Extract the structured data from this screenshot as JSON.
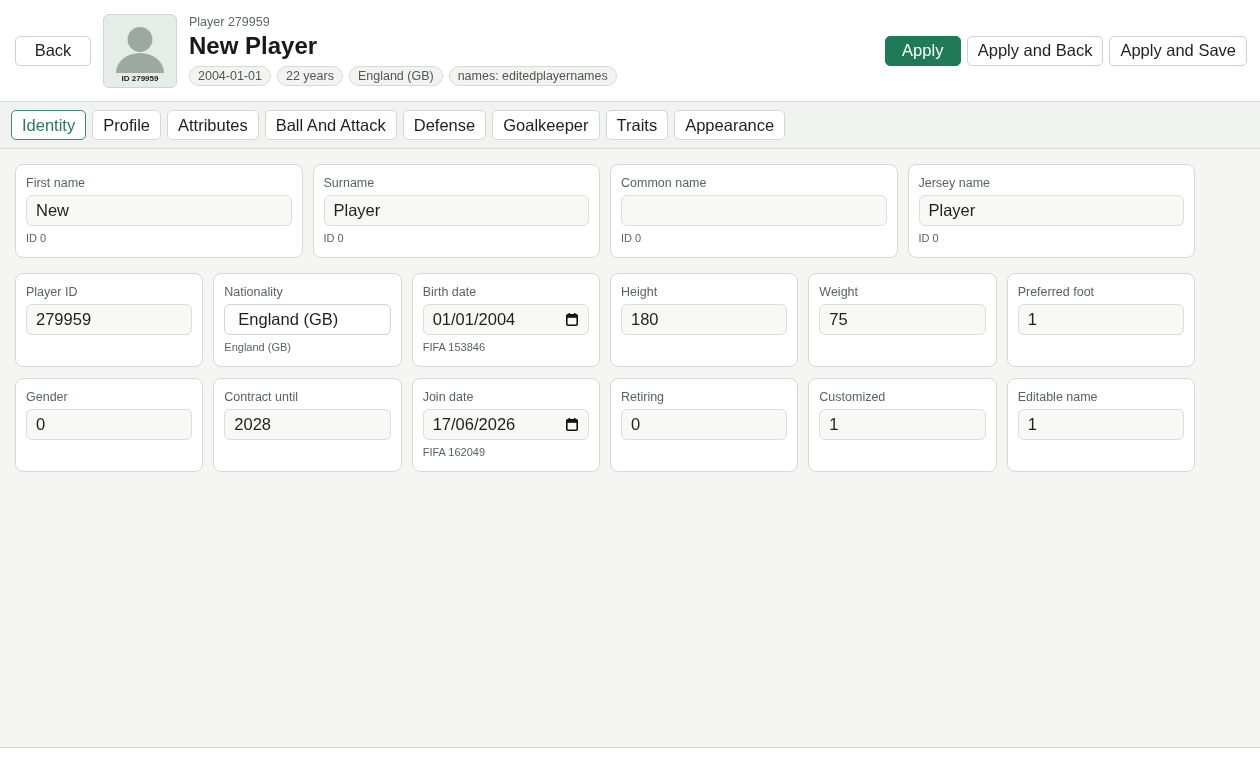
{
  "header": {
    "back_button": "Back",
    "avatar": {
      "caption": "ID 279959"
    },
    "subtitle": "Player 279959",
    "title": "New Player",
    "chips": [
      "2004-01-01",
      "22 years",
      "England (GB)",
      "names: editedplayernames"
    ],
    "actions": [
      {
        "label": "Apply",
        "kind": "primary"
      },
      {
        "label": "Apply and Back",
        "kind": "secondary"
      },
      {
        "label": "Apply and Save",
        "kind": "secondary"
      }
    ]
  },
  "tabs": [
    {
      "label": "Identity",
      "selected": true
    },
    {
      "label": "Profile",
      "selected": false
    },
    {
      "label": "Attributes",
      "selected": false
    },
    {
      "label": "Ball And Attack",
      "selected": false
    },
    {
      "label": "Defense",
      "selected": false
    },
    {
      "label": "Goalkeeper",
      "selected": false
    },
    {
      "label": "Traits",
      "selected": false
    },
    {
      "label": "Appearance",
      "selected": false
    }
  ],
  "field_groups": [
    {
      "rows": [
        [
          {
            "label": "First name",
            "kind": "text",
            "value": "New",
            "hint": "ID 0"
          },
          {
            "label": "Surname",
            "kind": "text",
            "value": "Player",
            "hint": "ID 0"
          },
          {
            "label": "Common name",
            "kind": "text",
            "hint": "ID 0"
          },
          {
            "label": "Jersey name",
            "kind": "text",
            "value": "Player",
            "hint": "ID 0"
          }
        ]
      ]
    },
    {
      "rows": [
        [
          {
            "label": "Player ID",
            "kind": "text",
            "value": "279959"
          },
          {
            "label": "Nationality",
            "kind": "select",
            "value": "England (GB)",
            "hint": "England (GB)"
          },
          {
            "label": "Birth date",
            "kind": "date",
            "value": "01/01/2004",
            "hint": "FIFA 153846"
          },
          {
            "label": "Height",
            "kind": "text",
            "value": "180"
          },
          {
            "label": "Weight",
            "kind": "text",
            "value": "75"
          },
          {
            "label": "Preferred foot",
            "kind": "text",
            "value": "1"
          }
        ],
        [
          {
            "label": "Gender",
            "kind": "text",
            "value": "0"
          },
          {
            "label": "Contract until",
            "kind": "text",
            "value": "2028"
          },
          {
            "label": "Join date",
            "kind": "date",
            "value": "17/06/2026",
            "hint": "FIFA 162049"
          },
          {
            "label": "Retiring",
            "kind": "text",
            "value": "0"
          },
          {
            "label": "Customized",
            "kind": "text",
            "value": "1"
          },
          {
            "label": "Editable name",
            "kind": "text",
            "value": "1"
          }
        ]
      ]
    }
  ]
}
